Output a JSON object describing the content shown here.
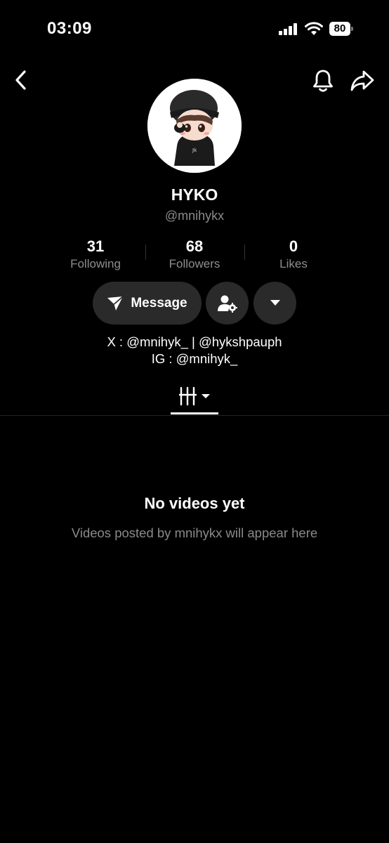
{
  "status_bar": {
    "time": "03:09",
    "battery": "80"
  },
  "profile": {
    "name": "HYKO",
    "handle": "@mnihykx",
    "avatar_icon": "chibi-avatar-image"
  },
  "stats": [
    {
      "value": "31",
      "label": "Following"
    },
    {
      "value": "68",
      "label": "Followers"
    },
    {
      "value": "0",
      "label": "Likes"
    }
  ],
  "actions": {
    "message_label": "Message",
    "friend_icon": "person-gear-icon",
    "more_icon": "caret-down-icon"
  },
  "bio": {
    "line1": "X : @mnihyk_ | @hykshpauph",
    "line2": "IG : @mnihyk_"
  },
  "tabs": {
    "active_icon": "grid-bars-icon"
  },
  "empty_state": {
    "title": "No videos yet",
    "subtitle": "Videos posted by mnihykx will appear here"
  }
}
